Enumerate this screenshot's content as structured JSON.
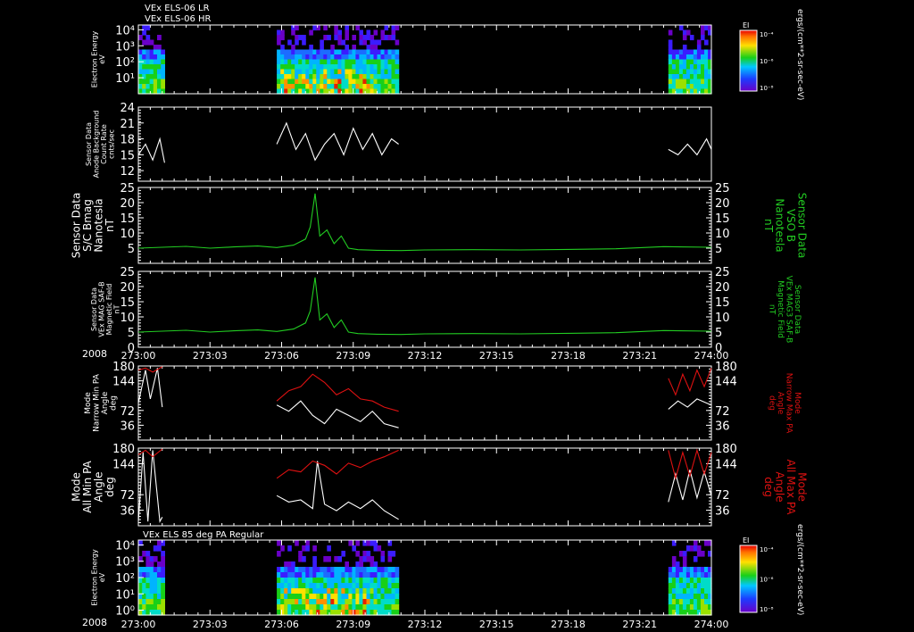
{
  "colors": {
    "background": "#000000",
    "axis": "#ffffff",
    "green": "#22cc22",
    "red": "#dd1111",
    "white": "#ffffff"
  },
  "header": {
    "line1": "VEx ELS-06 LR",
    "line2": "VEx ELS-06 HR"
  },
  "time_axis": {
    "year": "2008",
    "ticks": [
      "273:00",
      "273:03",
      "273:06",
      "273:09",
      "273:12",
      "273:15",
      "273:18",
      "273:21",
      "274:00"
    ]
  },
  "chart_data": [
    {
      "type": "heatmap",
      "id": "spectrogram-top",
      "ylabel": [
        "Electron Energy",
        "eV"
      ],
      "y_ticks": [
        "10⁴",
        "10³",
        "10²",
        "10¹"
      ],
      "y_scale": "log",
      "ylim": [
        1,
        20000
      ],
      "colorbar": {
        "label": "EI",
        "ticks": [
          "10⁻⁴",
          "10⁻⁶",
          "10⁻⁸"
        ],
        "units": "ergs/(cm**2-sr-sec-eV)"
      },
      "data_intervals_minutes": [
        [
          0,
          1.1
        ],
        [
          5.8,
          10.9
        ],
        [
          22.2,
          24
        ]
      ]
    },
    {
      "type": "line",
      "id": "anode-background",
      "ylabel": [
        "Sensor Data",
        "Anode Background",
        "Count Rate",
        "cnts/sec"
      ],
      "y_ticks": [
        "24",
        "21",
        "18",
        "15",
        "12"
      ],
      "ylim": [
        10,
        24
      ],
      "series": [
        {
          "color": "#ffffff",
          "segments": [
            {
              "x": [
                0.0,
                0.3,
                0.6,
                0.9,
                1.1
              ],
              "y": [
                15,
                17,
                14,
                18,
                13.5
              ]
            },
            {
              "x": [
                5.8,
                6.2,
                6.6,
                7.0,
                7.4,
                7.8,
                8.2,
                8.6,
                9.0,
                9.4,
                9.8,
                10.2,
                10.6,
                10.9
              ],
              "y": [
                17,
                21,
                16,
                19,
                14,
                17,
                19,
                15,
                20,
                16,
                19,
                15,
                18,
                17
              ]
            },
            {
              "x": [
                22.2,
                22.6,
                23.0,
                23.4,
                23.8,
                24.0
              ],
              "y": [
                16,
                15,
                17,
                15,
                18,
                16
              ]
            }
          ]
        }
      ]
    },
    {
      "type": "line",
      "id": "sc-bmag",
      "ylabel": [
        "Sensor Data",
        "S/C Bmag",
        "Nanotesla",
        "nT"
      ],
      "ylabel_right": [
        "Sensor Data",
        "VSO B",
        "Nanotesla",
        "nT"
      ],
      "y_ticks": [
        "25",
        "20",
        "15",
        "10",
        "5"
      ],
      "ylim": [
        0,
        25
      ],
      "series": [
        {
          "color": "#22cc22",
          "segments": [
            {
              "x": [
                0,
                1,
                2,
                3,
                4,
                5,
                5.8,
                6.5,
                7.0,
                7.2,
                7.4,
                7.6,
                7.9,
                8.2,
                8.5,
                8.8,
                9.2,
                10,
                11,
                12,
                14,
                16,
                18,
                20,
                22,
                24
              ],
              "y": [
                5,
                5.3,
                5.6,
                5,
                5.4,
                5.7,
                5.2,
                6,
                8,
                12,
                23,
                9,
                11,
                6.5,
                9,
                5,
                4.5,
                4.3,
                4.2,
                4.4,
                4.5,
                4.4,
                4.6,
                4.8,
                5.5,
                5.3
              ]
            }
          ]
        }
      ]
    },
    {
      "type": "line",
      "id": "mag-saf-b",
      "ylabel": [
        "Sensor Data",
        "VEx MAG SAF-B",
        "Magnetic Field",
        "nT"
      ],
      "ylabel_right": [
        "Sensor Data",
        "VEx MAG3 SAF-B",
        "Magnetic Field",
        "nT"
      ],
      "y_ticks": [
        "25",
        "20",
        "15",
        "10",
        "5",
        "0"
      ],
      "ylim": [
        0,
        25
      ],
      "series": [
        {
          "color": "#22cc22",
          "segments": [
            {
              "x": [
                0,
                1,
                2,
                3,
                4,
                5,
                5.8,
                6.5,
                7.0,
                7.2,
                7.4,
                7.6,
                7.9,
                8.2,
                8.5,
                8.8,
                9.2,
                10,
                11,
                12,
                14,
                16,
                18,
                20,
                22,
                24
              ],
              "y": [
                5,
                5.3,
                5.6,
                5,
                5.4,
                5.7,
                5.2,
                6,
                8,
                12,
                23,
                9,
                11,
                6.5,
                9,
                5,
                4.5,
                4.3,
                4.2,
                4.4,
                4.5,
                4.4,
                4.6,
                4.8,
                5.5,
                5.3
              ]
            }
          ]
        }
      ]
    },
    {
      "type": "line",
      "id": "narrow-pa",
      "ylabel": [
        "Mode",
        "Narrow Min PA",
        "Angle",
        "deg"
      ],
      "ylabel_right": [
        "Mode",
        "Narrow Max PA",
        "Angle",
        "deg"
      ],
      "y_ticks": [
        "180",
        "144",
        "108",
        "72",
        "36"
      ],
      "ylim": [
        0,
        180
      ],
      "series": [
        {
          "color": "#ffffff",
          "segments": [
            {
              "x": [
                0.0,
                0.3,
                0.5,
                0.8,
                1.0
              ],
              "y": [
                90,
                170,
                100,
                175,
                80
              ]
            },
            {
              "x": [
                5.8,
                6.3,
                6.8,
                7.3,
                7.8,
                8.3,
                8.8,
                9.3,
                9.8,
                10.3,
                10.9
              ],
              "y": [
                85,
                70,
                95,
                60,
                40,
                75,
                60,
                45,
                70,
                40,
                30
              ]
            },
            {
              "x": [
                22.2,
                22.6,
                23.0,
                23.4,
                23.8,
                24.0
              ],
              "y": [
                75,
                95,
                80,
                100,
                90,
                85
              ]
            }
          ]
        },
        {
          "color": "#dd1111",
          "segments": [
            {
              "x": [
                0.0,
                0.3,
                0.6,
                1.0
              ],
              "y": [
                170,
                175,
                165,
                178
              ]
            },
            {
              "x": [
                5.8,
                6.3,
                6.8,
                7.3,
                7.8,
                8.3,
                8.8,
                9.3,
                9.8,
                10.3,
                10.9
              ],
              "y": [
                95,
                120,
                130,
                160,
                140,
                110,
                125,
                100,
                95,
                80,
                70
              ]
            },
            {
              "x": [
                22.2,
                22.5,
                22.8,
                23.1,
                23.4,
                23.7,
                24.0
              ],
              "y": [
                150,
                110,
                160,
                120,
                170,
                130,
                175
              ]
            }
          ]
        }
      ]
    },
    {
      "type": "line",
      "id": "all-pa",
      "ylabel": [
        "Mode",
        "All Min PA",
        "Angle",
        "deg"
      ],
      "ylabel_right": [
        "Mode",
        "All Max PA",
        "Angle",
        "deg"
      ],
      "y_ticks": [
        "180",
        "144",
        "108",
        "72",
        "36"
      ],
      "ylim": [
        0,
        180
      ],
      "series": [
        {
          "color": "#ffffff",
          "segments": [
            {
              "x": [
                0.0,
                0.2,
                0.4,
                0.6,
                0.9,
                1.0
              ],
              "y": [
                10,
                170,
                10,
                175,
                10,
                20
              ]
            },
            {
              "x": [
                5.8,
                6.3,
                6.8,
                7.3,
                7.5,
                7.8,
                8.3,
                8.8,
                9.3,
                9.8,
                10.3,
                10.9
              ],
              "y": [
                70,
                55,
                60,
                40,
                150,
                50,
                35,
                55,
                40,
                60,
                35,
                15
              ]
            },
            {
              "x": [
                22.2,
                22.5,
                22.8,
                23.1,
                23.4,
                23.7,
                24.0
              ],
              "y": [
                55,
                120,
                60,
                130,
                65,
                125,
                70
              ]
            }
          ]
        },
        {
          "color": "#dd1111",
          "segments": [
            {
              "x": [
                0.0,
                0.3,
                0.6,
                1.0
              ],
              "y": [
                165,
                175,
                160,
                178
              ]
            },
            {
              "x": [
                5.8,
                6.3,
                6.8,
                7.3,
                7.8,
                8.3,
                8.8,
                9.3,
                9.8,
                10.3,
                10.9
              ],
              "y": [
                110,
                130,
                125,
                150,
                140,
                120,
                145,
                135,
                150,
                160,
                175
              ]
            },
            {
              "x": [
                22.2,
                22.5,
                22.8,
                23.1,
                23.4,
                23.7,
                24.0
              ],
              "y": [
                175,
                110,
                170,
                115,
                175,
                120,
                170
              ]
            }
          ]
        }
      ]
    },
    {
      "type": "heatmap",
      "id": "spectrogram-bottom",
      "title": "VEx ELS 85 deg PA Regular",
      "ylabel": [
        "Electron Energy",
        "eV"
      ],
      "y_ticks": [
        "10⁴",
        "10³",
        "10²",
        "10¹",
        "10⁰"
      ],
      "y_scale": "log",
      "ylim": [
        0.5,
        20000
      ],
      "colorbar": {
        "label": "EI",
        "ticks": [
          "10⁻⁴",
          "10⁻⁶",
          "10⁻⁸"
        ],
        "units": "ergs/(cm**2-sr-sec-eV)"
      },
      "data_intervals_minutes": [
        [
          0,
          1.1
        ],
        [
          5.8,
          10.9
        ],
        [
          22.2,
          24
        ]
      ]
    }
  ]
}
